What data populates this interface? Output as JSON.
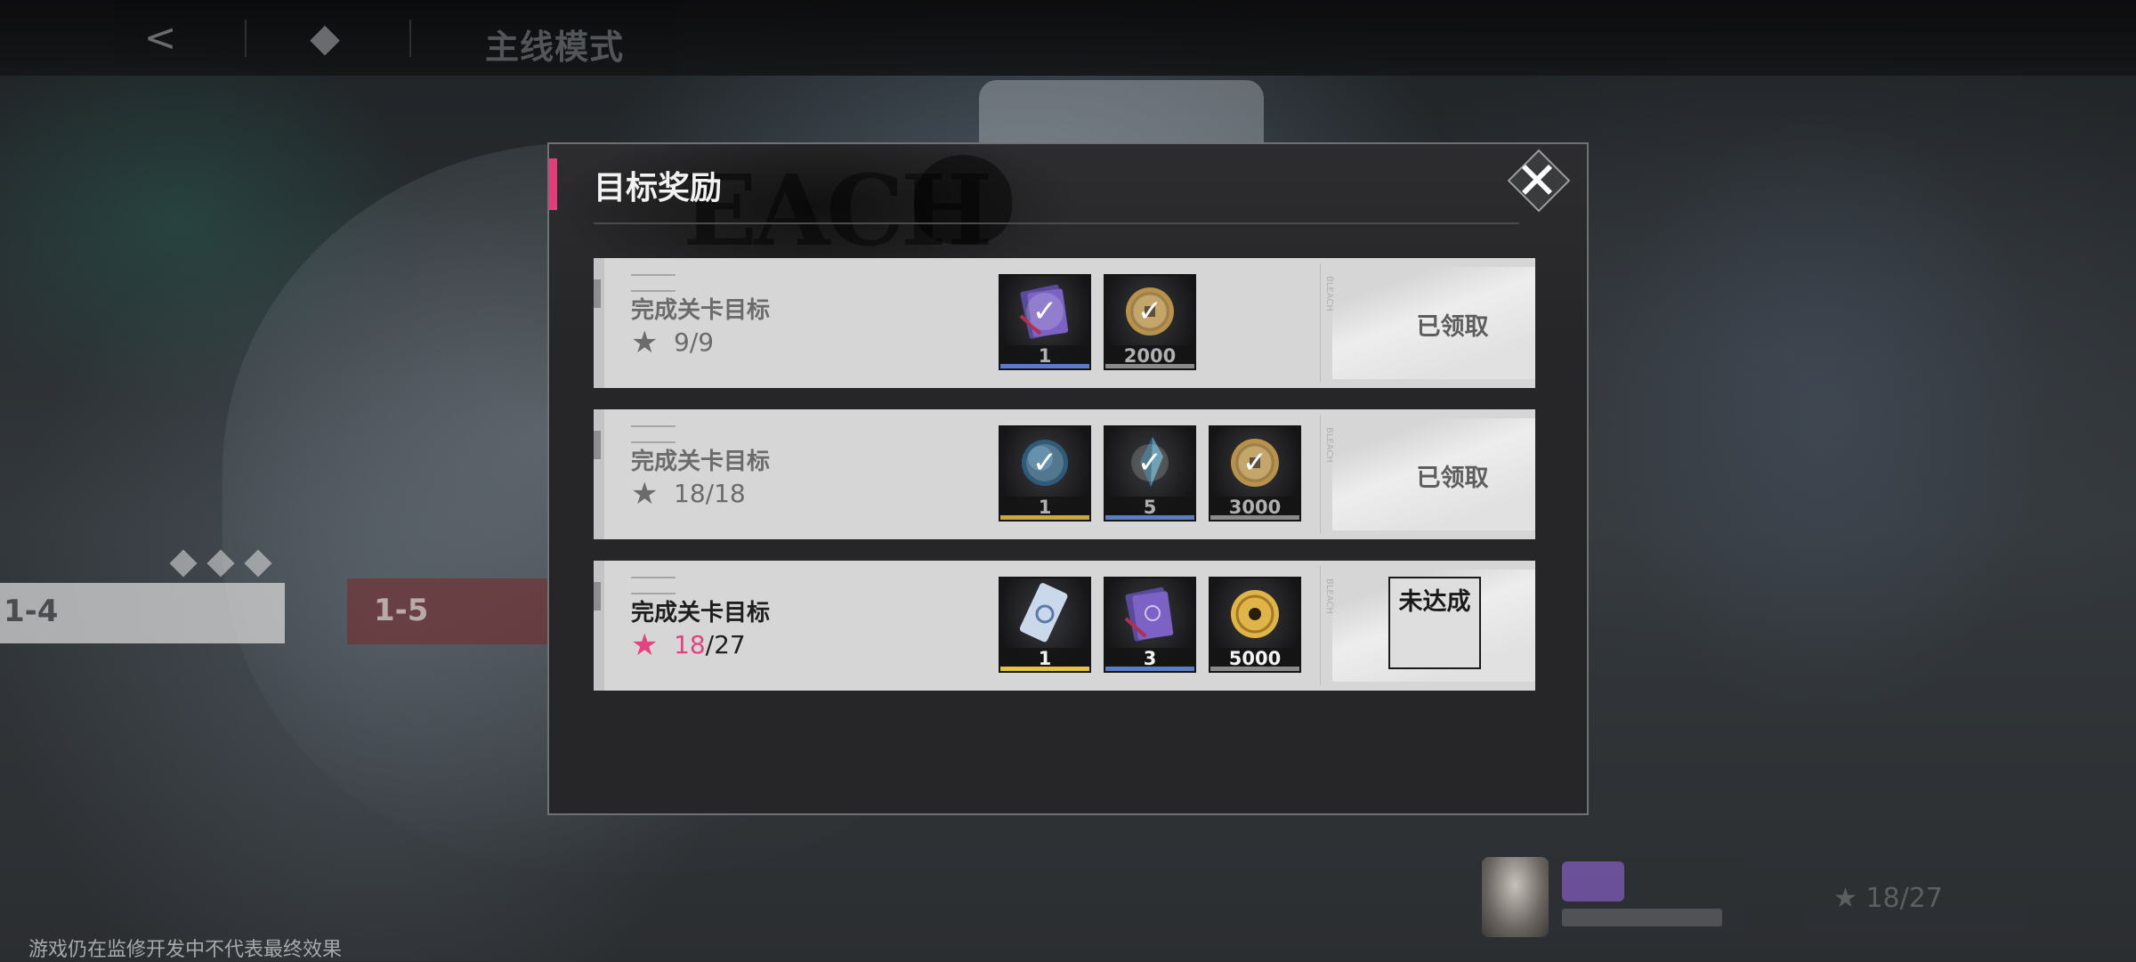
{
  "topbar": {
    "mode_title": "主线模式"
  },
  "background": {
    "stage_left": "1-4",
    "stage_right": "1-5",
    "power": "18/27"
  },
  "watermark": "游戏仍在监修开发中不代表最终效果",
  "modal": {
    "title": "目标奖励",
    "brand_text": "EACH",
    "rows": [
      {
        "goal": "完成关卡目标",
        "progress_current": "9",
        "progress_total": "/9",
        "status": "已领取",
        "items": [
          {
            "icon": "purple-book-icon",
            "qty": "1",
            "rarity": "#5b7cc9"
          },
          {
            "icon": "gold-coin-icon",
            "qty": "2000",
            "rarity": "#8a8a8a"
          }
        ]
      },
      {
        "goal": "完成关卡目标",
        "progress_current": "18",
        "progress_total": "/18",
        "status": "已领取",
        "items": [
          {
            "icon": "orb-icon",
            "qty": "1",
            "rarity": "#c9a83a"
          },
          {
            "icon": "crystal-icon",
            "qty": "5",
            "rarity": "#5b7cc9"
          },
          {
            "icon": "gold-coin-icon",
            "qty": "3000",
            "rarity": "#8a8a8a"
          }
        ]
      },
      {
        "goal": "完成关卡目标",
        "progress_current": "18",
        "progress_total": "/27",
        "status": "未达成",
        "items": [
          {
            "icon": "ticket-icon",
            "qty": "1",
            "rarity": "#e8c33a"
          },
          {
            "icon": "purple-book-icon",
            "qty": "3",
            "rarity": "#5b7cc9"
          },
          {
            "icon": "gold-coin-icon",
            "qty": "5000",
            "rarity": "#8a8a8a"
          }
        ]
      }
    ]
  },
  "colors": {
    "accent_pink": "#e4437f",
    "panel": "#262628",
    "row": "#d6d6d6"
  }
}
